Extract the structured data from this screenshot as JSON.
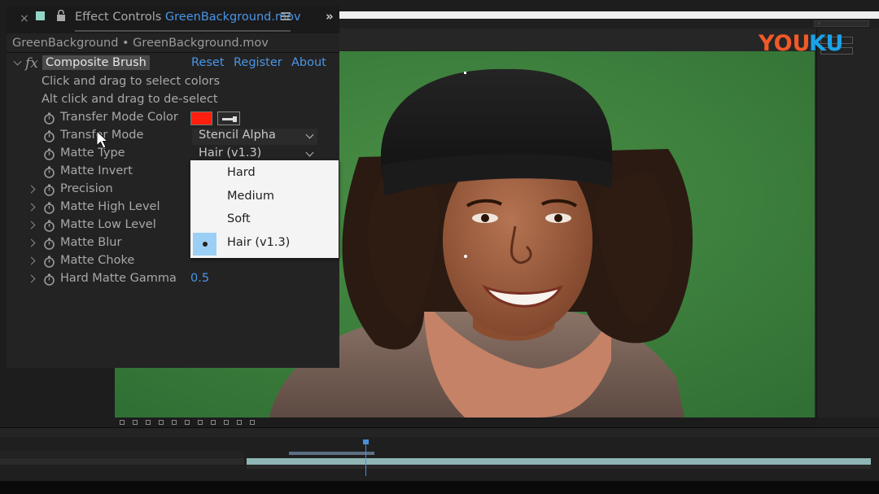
{
  "effect_controls": {
    "tab_title": "Effect Controls",
    "tab_file": "GreenBackground.mov",
    "comp_line": "GreenBackground • GreenBackground.mov",
    "effect_name": "Composite Brush",
    "links": [
      "Reset",
      "Register",
      "About"
    ],
    "help_lines": [
      "Click and drag to select colors",
      "Alt click and drag to de-select"
    ],
    "properties": [
      {
        "label": "Transfer Mode Color",
        "twirl": false
      },
      {
        "label": "Transfer Mode",
        "twirl": false,
        "value": "Stencil Alpha"
      },
      {
        "label": "Matte Type",
        "twirl": false,
        "value": "Hair (v1.3)"
      },
      {
        "label": "Matte Invert",
        "twirl": false
      },
      {
        "label": "Precision",
        "twirl": true
      },
      {
        "label": "Matte High Level",
        "twirl": true
      },
      {
        "label": "Matte Low Level",
        "twirl": true
      },
      {
        "label": "Matte Blur",
        "twirl": true
      },
      {
        "label": "Matte Choke",
        "twirl": true
      },
      {
        "label": "Hard Matte Gamma",
        "twirl": true,
        "value": "0.5"
      }
    ],
    "transfer_color": "#ff1f0f"
  },
  "matte_type_menu": {
    "options": [
      "Hard",
      "Medium",
      "Soft",
      "Hair (v1.3)"
    ],
    "selected": "Hair (v1.3)"
  },
  "watermark": {
    "text": "YOUKU"
  },
  "accent_color": "#4a95e6"
}
